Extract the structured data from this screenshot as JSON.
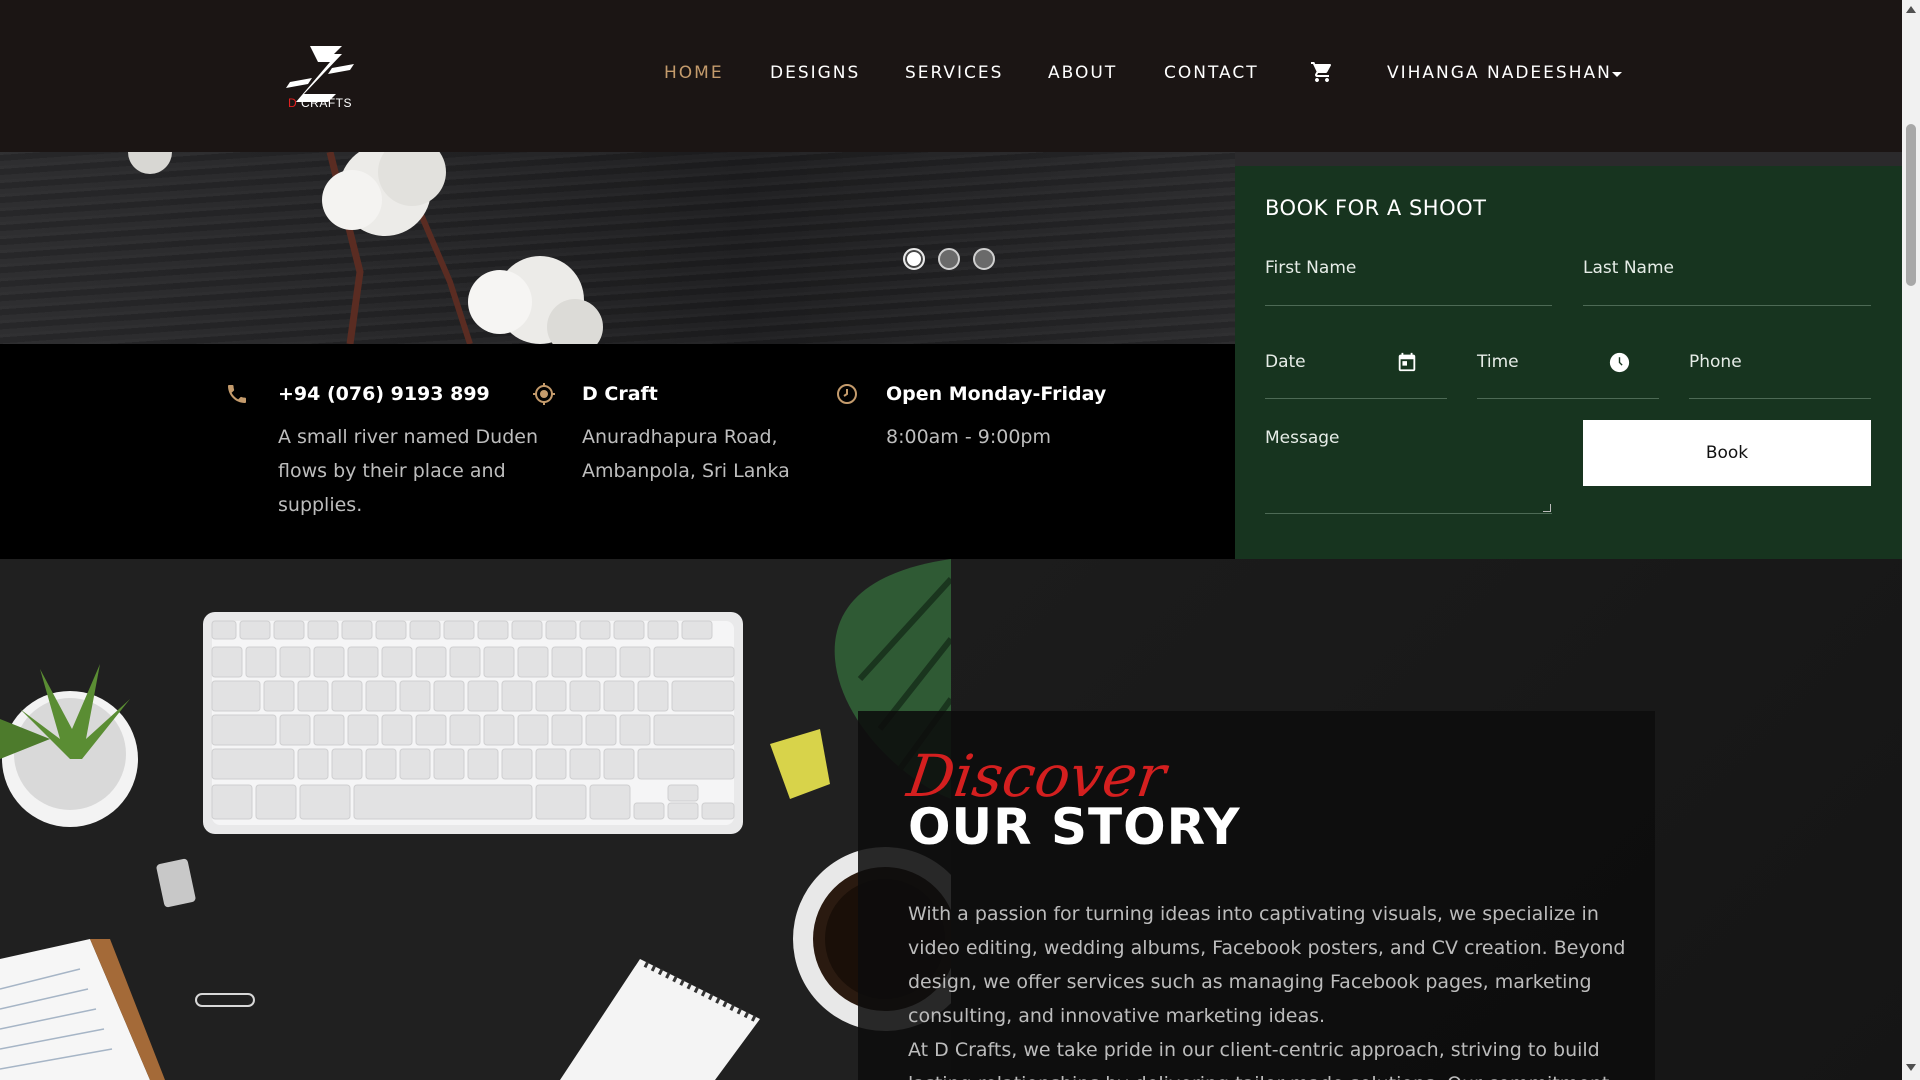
{
  "brand": {
    "logo_letter": "D",
    "logo_text_red": "D",
    "logo_text_rest": "CRAFTS"
  },
  "nav": {
    "items": [
      {
        "label": "HOME",
        "active": true
      },
      {
        "label": "DESIGNS",
        "active": false
      },
      {
        "label": "SERVICES",
        "active": false
      },
      {
        "label": "ABOUT",
        "active": false
      },
      {
        "label": "CONTACT",
        "active": false
      }
    ],
    "cart_icon": "cart-icon",
    "user_name": "VIHANGA NADEESHAN"
  },
  "hero": {
    "slides": 3,
    "active_slide": 1
  },
  "info": {
    "phone": {
      "title": "+94 (076) 9193 899",
      "text": "A small river named Duden flows by their place and supplies.",
      "icon": "phone-icon"
    },
    "location": {
      "title": "D Craft",
      "text": "Anuradhapura Road, Ambanpola, Sri Lanka",
      "icon": "location-icon"
    },
    "hours": {
      "title": "Open Monday-Friday",
      "text": "8:00am - 9:00pm",
      "icon": "clock-icon"
    }
  },
  "booking": {
    "title": "BOOK FOR A SHOOT",
    "first_name": "First Name",
    "last_name": "Last Name",
    "date": "Date",
    "time": "Time",
    "phone": "Phone",
    "message": "Message",
    "button": "Book"
  },
  "story": {
    "kicker": "Discover",
    "heading": "OUR STORY",
    "paragraph1": "With a passion for turning ideas into captivating visuals, we specialize in video editing, wedding albums, Facebook posters, and CV creation. Beyond design, we offer services such as managing Facebook pages, marketing consulting, and innovative marketing ideas.",
    "paragraph2": "At D Crafts, we take pride in our client-centric approach, striving to build lasting relationships by delivering tailor-made solutions. Our commitment"
  },
  "colors": {
    "nav_bg": "#1b1514",
    "accent": "#c49b6c",
    "form_bg": "#17341f",
    "discover_red": "#d41f1f"
  }
}
